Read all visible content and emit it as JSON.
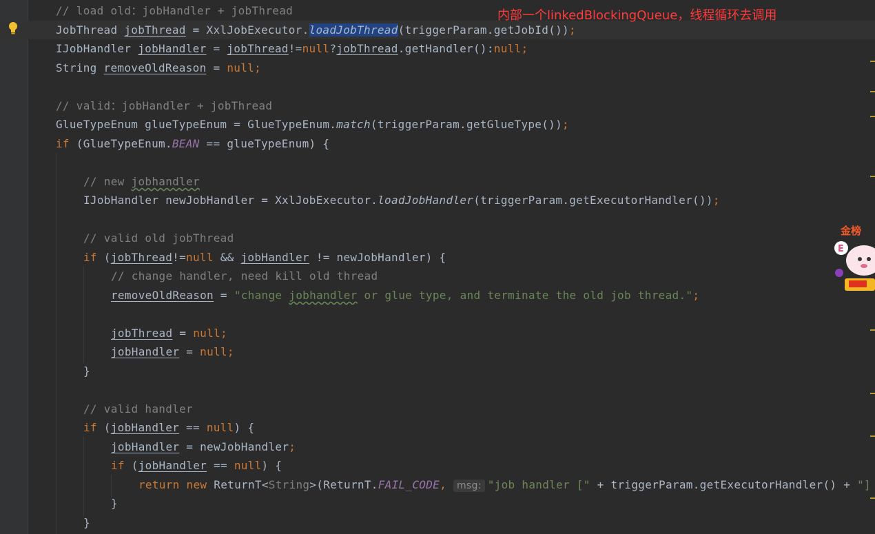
{
  "annotation": "内部一个linkedBlockingQueue，线程循环去调用",
  "hint_label": "msg:",
  "sticker_text": "金榜",
  "code": {
    "l1_comment": "// load old：jobHandler + jobThread",
    "l2_type": "JobThread ",
    "l2_var": "jobThread",
    "l2_eq": " = XxlJobExecutor.",
    "l2_method": "loadJobThread",
    "l2_args": "(triggerParam.getJobId())",
    "l2_semi": ";",
    "l3_type": "IJobHandler ",
    "l3_var": "jobHandler",
    "l3_eq": " = ",
    "l3_jt": "jobThread",
    "l3_ne": "!=",
    "l3_null1": "null",
    "l3_q": "?",
    "l3_jt2": "jobThread",
    "l3_get": ".getHandler():",
    "l3_null2": "null",
    "l3_semi": ";",
    "l4_type": "String ",
    "l4_var": "removeOldReason",
    "l4_eq": " = ",
    "l4_null": "null",
    "l4_semi": ";",
    "l6_comment": "// valid：jobHandler + jobThread",
    "l7_a": "GlueTypeEnum glueTypeEnum = GlueTypeEnum.",
    "l7_method": "match",
    "l7_args": "(triggerParam.getGlueType())",
    "l7_semi": ";",
    "l8_kw": "if",
    "l8_a": " (GlueTypeEnum.",
    "l8_const": "BEAN",
    "l8_b": " == glueTypeEnum) {",
    "l10_comment_a": "// new ",
    "l10_comment_b": "jobhandler",
    "l11_a": "IJobHandler newJobHandler = XxlJobExecutor.",
    "l11_method": "loadJobHandler",
    "l11_args": "(triggerParam.getExecutorHandler())",
    "l11_semi": ";",
    "l13_comment": "// valid old jobThread",
    "l14_kw": "if",
    "l14_a": " (",
    "l14_jt": "jobThread",
    "l14_ne": "!=",
    "l14_null": "null",
    "l14_and": " && ",
    "l14_jh": "jobHandler",
    "l14_b": " != newJobHandler) {",
    "l15_comment": "// change handler, need kill old thread",
    "l16_var": "removeOldReason",
    "l16_eq": " = ",
    "l16_str_a": "\"change ",
    "l16_str_b": "jobhandler",
    "l16_str_c": " or glue type, and terminate the old job thread.\"",
    "l16_semi": ";",
    "l18_var": "jobThread",
    "l18_eq": " = ",
    "l18_null": "null",
    "l18_semi": ";",
    "l19_var": "jobHandler",
    "l19_eq": " = ",
    "l19_null": "null",
    "l19_semi": ";",
    "l20_brace": "}",
    "l22_comment": "// valid handler",
    "l23_kw": "if",
    "l23_a": " (",
    "l23_var": "jobHandler",
    "l23_eq": " == ",
    "l23_null": "null",
    "l23_b": ") {",
    "l24_var": "jobHandler",
    "l24_eq": " = newJobHandler",
    "l24_semi": ";",
    "l25_kw": "if",
    "l25_a": " (",
    "l25_var": "jobHandler",
    "l25_eq": " == ",
    "l25_null": "null",
    "l25_b": ") {",
    "l26_kw1": "return",
    "l26_sp": " ",
    "l26_kw2": "new",
    "l26_a": " ReturnT<",
    "l26_type": "String",
    "l26_b": ">(ReturnT.",
    "l26_const": "FAIL_CODE",
    "l26_comma": ", ",
    "l26_str": "\"job handler [\"",
    "l26_c": " + triggerParam.getExecutorHandler() + ",
    "l26_str2": "\"]",
    "l27_brace": "}",
    "l28_brace": "}"
  }
}
